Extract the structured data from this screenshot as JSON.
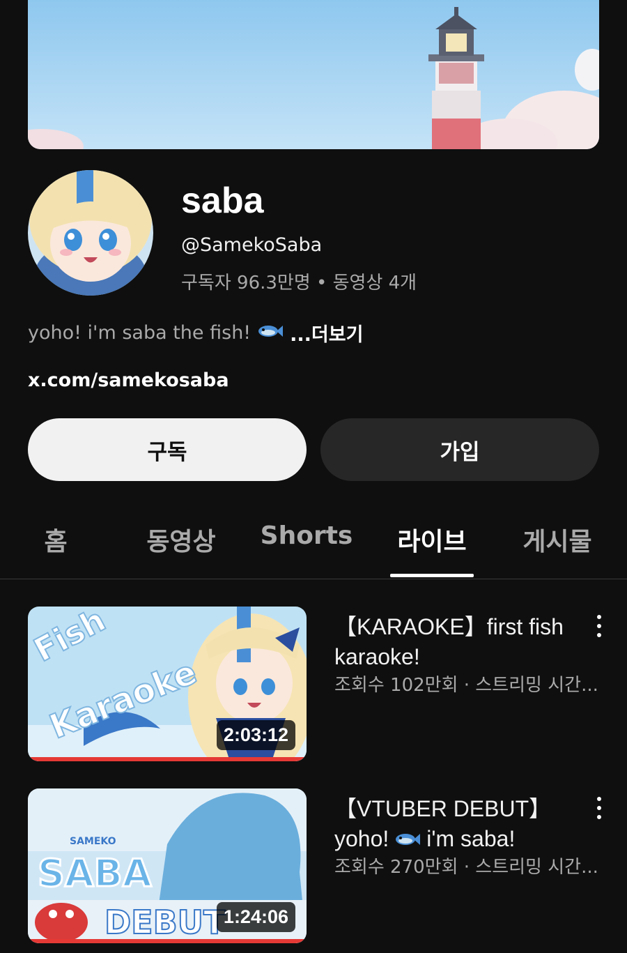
{
  "channel": {
    "name": "saba",
    "handle": "@SamekoSaba",
    "stats": "구독자 96.3만명 • 동영상 4개",
    "description": "yoho! i'm saba the fish!",
    "more_label": "...더보기",
    "link": "x.com/samekosaba"
  },
  "buttons": {
    "subscribe": "구독",
    "join": "가입"
  },
  "tabs": [
    {
      "label": "홈"
    },
    {
      "label": "동영상"
    },
    {
      "label": "Shorts"
    },
    {
      "label": "라이브",
      "active": true
    },
    {
      "label": "게시물"
    }
  ],
  "videos": [
    {
      "title": "【KARAOKE】first fish karaoke!",
      "meta": "조회수 102만회 · 스트리밍 시간...",
      "duration": "2:03:12",
      "thumb_text": [
        "Fish",
        "Karaoke"
      ]
    },
    {
      "title": "【VTUBER DEBUT】 yoho! 🐟 i'm saba!",
      "title_line1": "【VTUBER DEBUT】",
      "title_line2a": "yoho!",
      "title_line2b": "i'm saba!",
      "meta": "조회수 270만회 · 스트리밍 시간...",
      "duration": "1:24:06",
      "thumb_text": [
        "SAMEKO",
        "SABA",
        "DEBUT"
      ]
    }
  ],
  "colors": {
    "background": "#0f0f0f",
    "subscribe_bg": "#f1f1f1",
    "join_bg": "#272727",
    "progress": "#e53935",
    "sky": "#a8d4f0"
  }
}
